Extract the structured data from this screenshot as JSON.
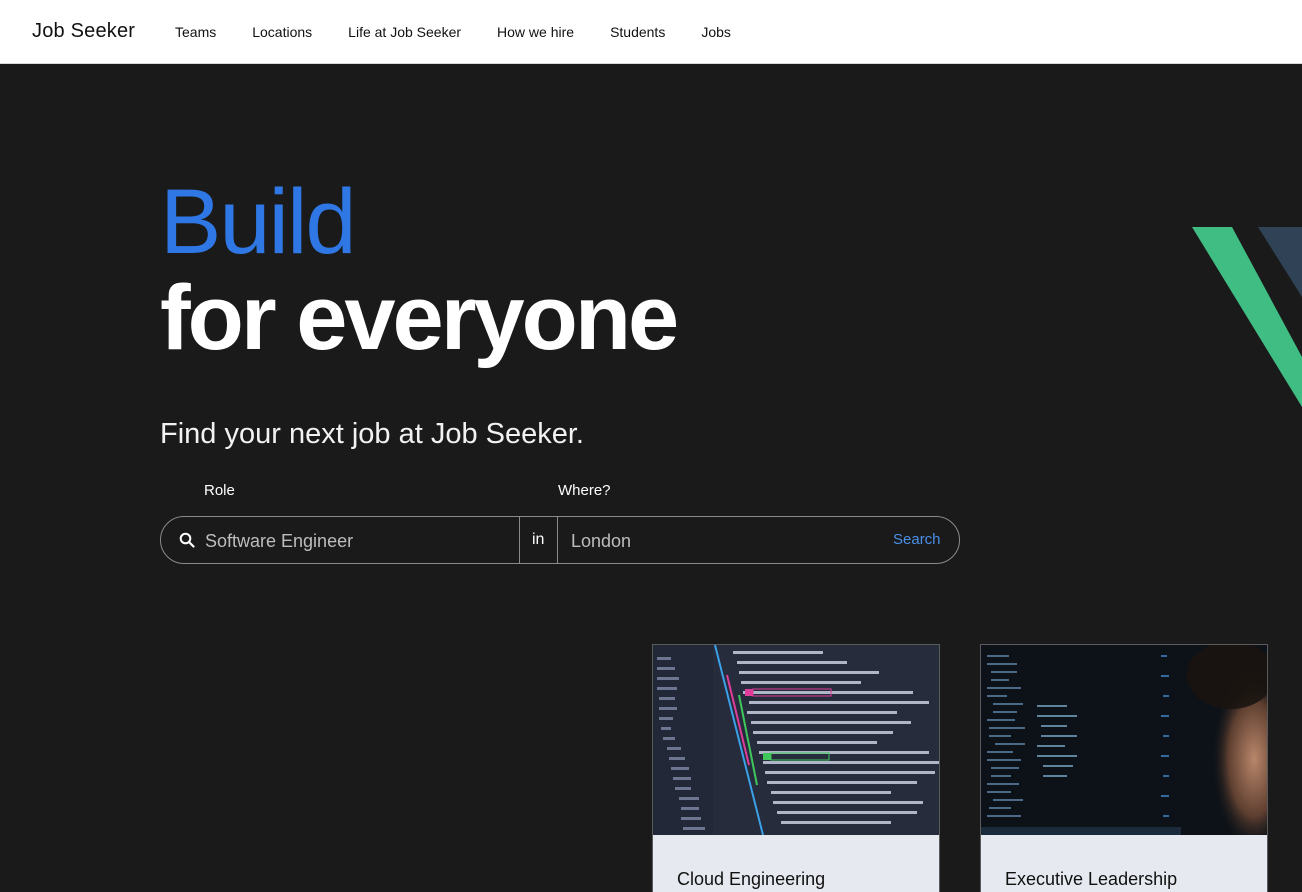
{
  "header": {
    "brand": "Job Seeker",
    "nav": [
      "Teams",
      "Locations",
      "Life at Job Seeker",
      "How we hire",
      "Students",
      "Jobs"
    ]
  },
  "hero": {
    "headline_accent": "Build",
    "headline_main": "for everyone",
    "subtitle": "Find your next job at Job Seeker.",
    "accent_color": "#2e77e5"
  },
  "search": {
    "role_label": "Role",
    "where_label": "Where?",
    "role_placeholder": "Software Engineer",
    "connector": "in",
    "location_placeholder": "London",
    "search_label": "Search",
    "search_icon": "search-icon"
  },
  "cards": [
    {
      "title": "Cloud Engineering",
      "image": "code-editor-image"
    },
    {
      "title": "Executive Leadership",
      "image": "person-at-monitors-image"
    }
  ]
}
